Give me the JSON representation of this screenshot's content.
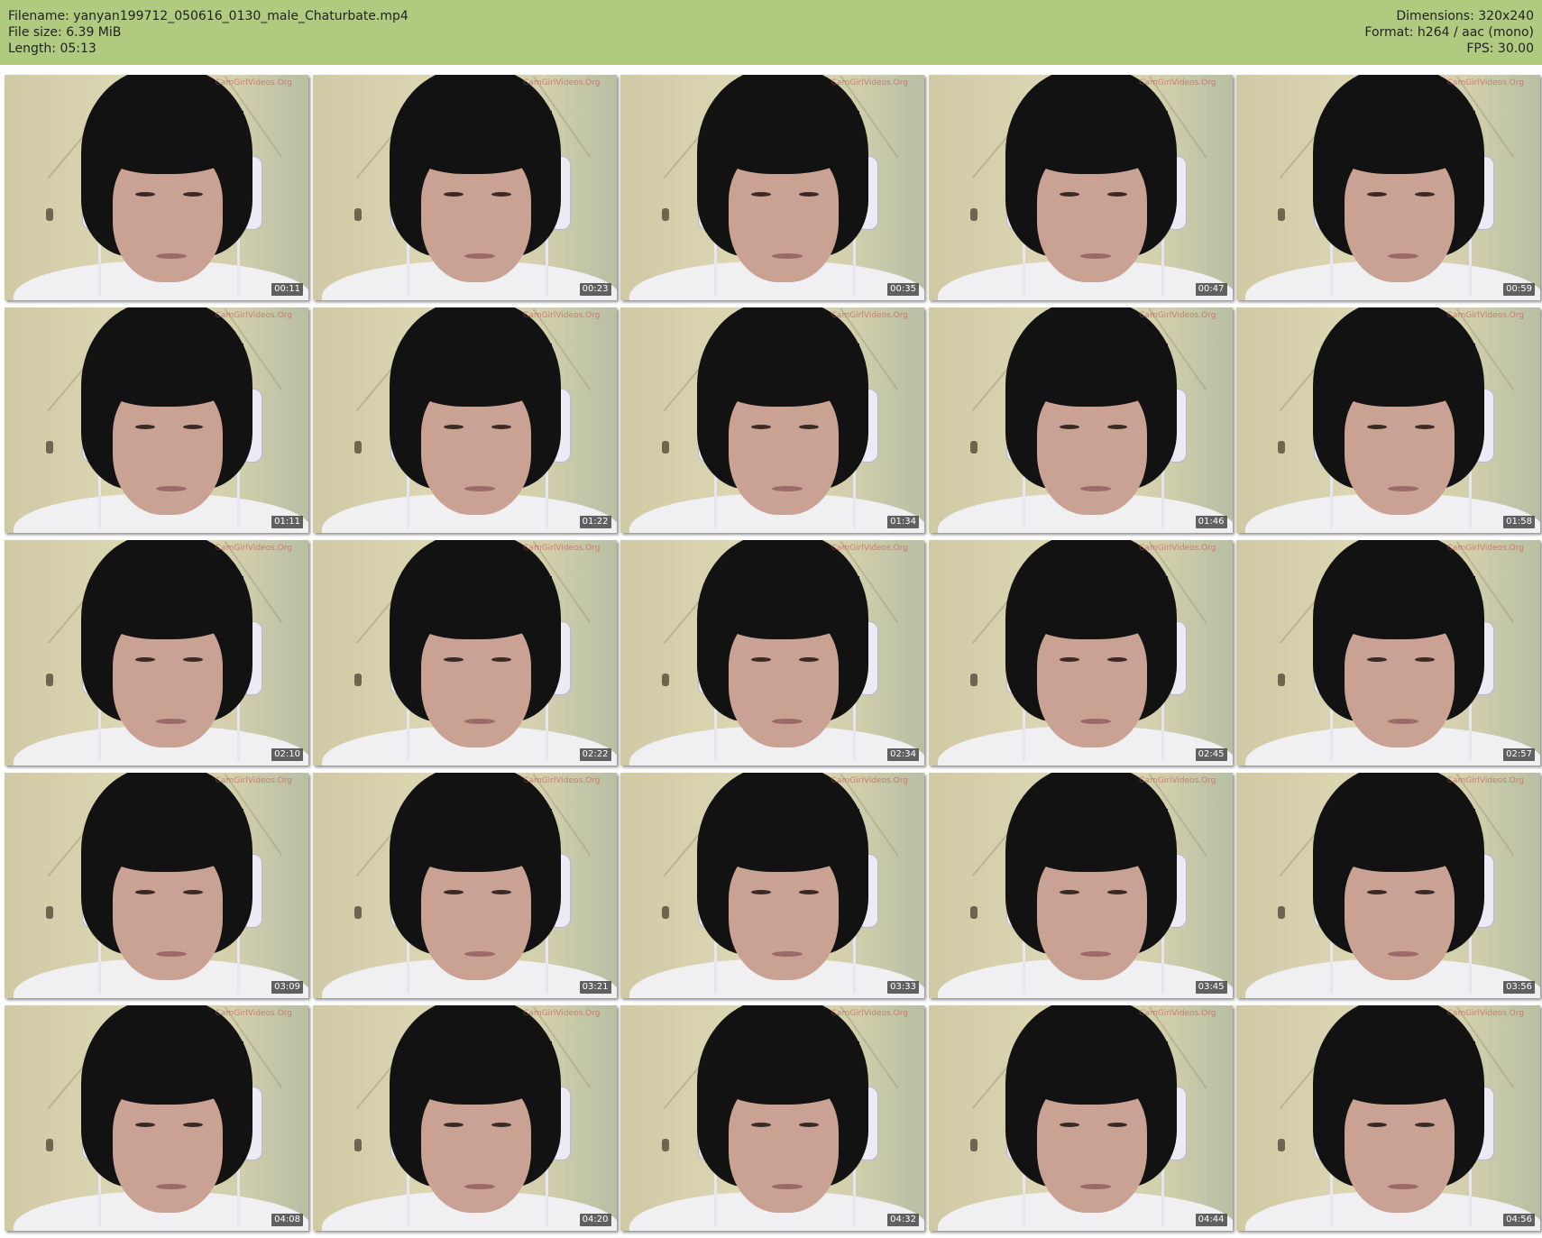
{
  "header": {
    "filename": "Filename: yanyan199712_050616_0130_male_Chaturbate.mp4",
    "file_size": "File size: 6.39 MiB",
    "length": "Length: 05:13",
    "dimensions": "Dimensions: 320x240",
    "format": "Format: h264 / aac (mono)",
    "fps": "FPS: 30.00"
  },
  "watermark": "CamGirlVideos.Org",
  "colors": {
    "header_bg": "#b0cb80",
    "page_bg": "#ffffff",
    "timestamp_bg": "#000000"
  },
  "thumbnails": [
    {
      "time": "00:11"
    },
    {
      "time": "00:23"
    },
    {
      "time": "00:35"
    },
    {
      "time": "00:47"
    },
    {
      "time": "00:59"
    },
    {
      "time": "01:11"
    },
    {
      "time": "01:22"
    },
    {
      "time": "01:34"
    },
    {
      "time": "01:46"
    },
    {
      "time": "01:58"
    },
    {
      "time": "02:10"
    },
    {
      "time": "02:22"
    },
    {
      "time": "02:34"
    },
    {
      "time": "02:45"
    },
    {
      "time": "02:57"
    },
    {
      "time": "03:09"
    },
    {
      "time": "03:21"
    },
    {
      "time": "03:33"
    },
    {
      "time": "03:45"
    },
    {
      "time": "03:56"
    },
    {
      "time": "04:08"
    },
    {
      "time": "04:20"
    },
    {
      "time": "04:32"
    },
    {
      "time": "04:44"
    },
    {
      "time": "04:56"
    }
  ]
}
